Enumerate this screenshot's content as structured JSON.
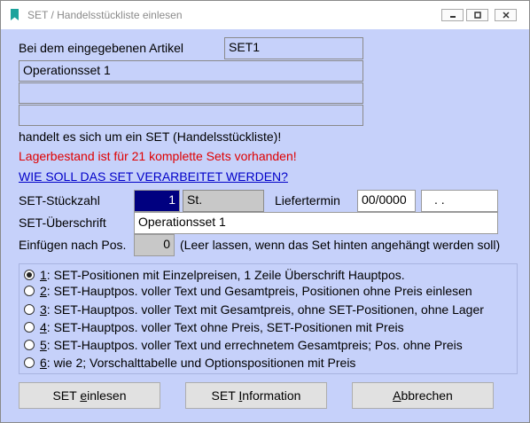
{
  "window": {
    "title": "SET / Handelsstückliste einlesen"
  },
  "header": {
    "prefix_label": "Bei dem eingegebenen Artikel",
    "article": "SET1",
    "description_lines": [
      "Operationsset 1",
      "",
      ""
    ],
    "suffix_label": "handelt es sich um ein SET (Handelsstückliste)!",
    "stock_warning": "Lagerbestand ist für 21 komplette Sets vorhanden!",
    "question": "WIE SOLL DAS SET VERARBEITET WERDEN?"
  },
  "form": {
    "qty_label": "SET-Stückzahl",
    "qty_value": "1",
    "unit": "St.",
    "delivery_label": "Liefertermin",
    "delivery_period": "00/0000",
    "delivery_date": ". .",
    "heading_label": "SET-Überschrift",
    "heading_value": "Operationsset 1",
    "insert_label": "Einfügen nach Pos.",
    "insert_value": "0",
    "insert_hint": "(Leer lassen, wenn das Set hinten angehängt werden soll)"
  },
  "options": [
    {
      "key": "1",
      "text": ": SET-Positionen mit Einzelpreisen, 1 Zeile Überschrift Hauptpos.",
      "checked": true
    },
    {
      "key": "2",
      "text": ": SET-Hauptpos. voller Text und Gesamtpreis, Positionen ohne Preis einlesen",
      "checked": false
    },
    {
      "key": "3",
      "text": ": SET-Hauptpos. voller Text mit Gesamtpreis, ohne SET-Positionen, ohne Lager",
      "checked": false
    },
    {
      "key": "4",
      "text": ": SET-Hauptpos. voller Text ohne Preis, SET-Positionen mit Preis",
      "checked": false
    },
    {
      "key": "5",
      "text": ": SET-Hauptpos. voller Text und errechnetem Gesamtpreis; Pos. ohne Preis",
      "checked": false
    },
    {
      "key": "6",
      "text": ": wie 2; Vorschalttabelle und Optionspositionen mit Preis",
      "checked": false
    }
  ],
  "buttons": {
    "read_pre": "SET ",
    "read_acc": "e",
    "read_post": "inlesen",
    "info_pre": "SET ",
    "info_acc": "I",
    "info_post": "nformation",
    "cancel_pre": "",
    "cancel_acc": "A",
    "cancel_post": "bbrechen"
  },
  "colors": {
    "background": "#c6d1fa",
    "warning": "#e00000",
    "link": "#0000c8",
    "qty_field": "#000080"
  }
}
